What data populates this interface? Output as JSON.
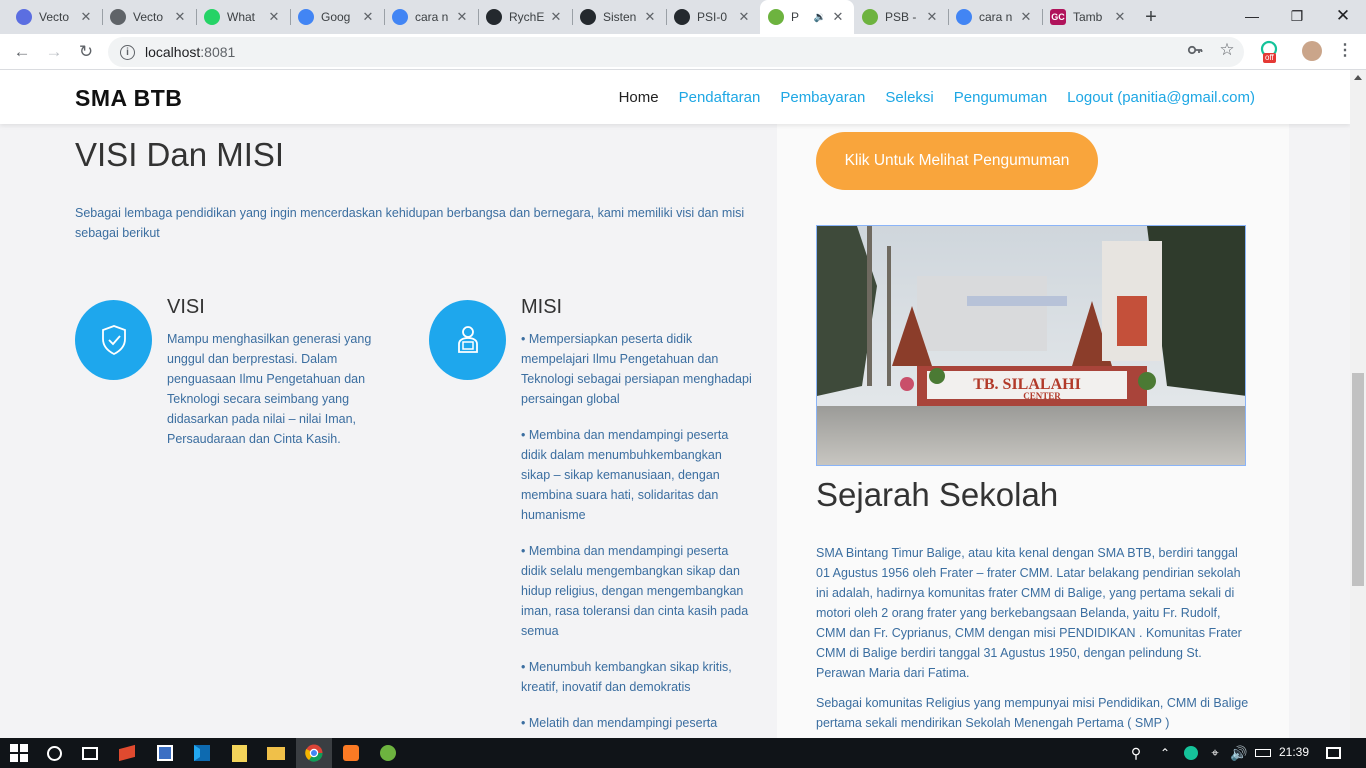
{
  "browser": {
    "tabs": [
      {
        "title": "Vecto",
        "favicon": "c-icon",
        "color": "#5b6ee1",
        "active": false
      },
      {
        "title": "Vecto",
        "favicon": "globe-icon",
        "color": "#5f6368",
        "active": false
      },
      {
        "title": "What",
        "favicon": "whatsapp-icon",
        "color": "#25d366",
        "active": false
      },
      {
        "title": "Goog",
        "favicon": "google-translate-icon",
        "color": "#4285f4",
        "active": false
      },
      {
        "title": "cara n",
        "favicon": "google-icon",
        "color": "#4285f4",
        "active": false
      },
      {
        "title": "RychE",
        "favicon": "github-icon",
        "color": "#24292e",
        "active": false
      },
      {
        "title": "Sisten",
        "favicon": "github-icon",
        "color": "#24292e",
        "active": false
      },
      {
        "title": "PSI-0",
        "favicon": "github-icon",
        "color": "#24292e",
        "active": false
      },
      {
        "title": "P",
        "favicon": "spring-leaf-icon",
        "color": "#6db33f",
        "active": true
      },
      {
        "title": "PSB -",
        "favicon": "spring-leaf-icon",
        "color": "#6db33f",
        "active": false
      },
      {
        "title": "cara n",
        "favicon": "google-icon",
        "color": "#4285f4",
        "active": false
      },
      {
        "title": "Tamb",
        "favicon": "gc-icon",
        "color": "#b0135b",
        "active": false
      }
    ],
    "gc_label": "GC",
    "url_host": "localhost",
    "url_port": ":8081",
    "extension_badge": "off"
  },
  "site": {
    "brand": "SMA BTB",
    "menu": [
      {
        "label": "Home"
      },
      {
        "label": "Pendaftaran"
      },
      {
        "label": "Pembayaran"
      },
      {
        "label": "Seleksi"
      },
      {
        "label": "Pengumuman"
      },
      {
        "label": "Logout (panitia@gmail.com)"
      }
    ]
  },
  "main": {
    "heading": "VISI Dan MISI",
    "intro": "Sebagai lembaga pendidikan yang ingin mencerdaskan kehidupan berbangsa dan bernegara, kami memiliki visi dan misi sebagai berikut",
    "visi": {
      "title": "VISI",
      "text": "Mampu menghasilkan generasi yang unggul dan berprestasi. Dalam penguasaan Ilmu Pengetahuan dan Teknologi secara seimbang yang didasarkan pada nilai – nilai Iman, Persaudaraan dan Cinta Kasih."
    },
    "misi": {
      "title": "MISI",
      "items": [
        "• Mempersiapkan peserta didik mempelajari Ilmu Pengetahuan dan Teknologi sebagai persiapan menghadapi persaingan global",
        "• Membina dan mendampingi peserta didik dalam menumbuhkembangkan sikap – sikap kemanusiaan, dengan membina suara hati, solidaritas dan humanisme",
        "• Membina dan mendampingi peserta didik selalu mengembangkan sikap dan hidup religius, dengan mengembangkan iman, rasa toleransi dan cinta kasih pada semua",
        "• Menumbuh kembangkan sikap kritis, kreatif, inovatif dan demokratis",
        "• Melatih dan mendampingi peserta"
      ]
    }
  },
  "side": {
    "button_label": "Klik Untuk Melihat Pengumuman",
    "photo_sign": "TB. SILALAHI",
    "photo_sign_sub": "CENTER",
    "heading": "Sejarah Sekolah",
    "paragraphs": [
      "SMA Bintang Timur Balige, atau kita kenal dengan SMA BTB, berdiri tanggal 01 Agustus 1956 oleh Frater – frater CMM. Latar belakang pendirian sekolah ini adalah, hadirnya komunitas frater CMM di Balige, yang pertama sekali di motori oleh 2 orang frater yang berkebangsaan Belanda, yaitu Fr. Rudolf, CMM dan Fr. Cyprianus, CMM dengan misi PENDIDIKAN . Komunitas Frater CMM di Balige berdiri tanggal 31 Agustus 1950, dengan pelindung St. Perawan Maria dari Fatima.",
      "Sebagai komunitas Religius yang mempunyai misi Pendidikan, CMM di Balige pertama sekali mendirikan Sekolah Menengah Pertama ( SMP )"
    ]
  },
  "taskbar": {
    "time": "21:39"
  }
}
